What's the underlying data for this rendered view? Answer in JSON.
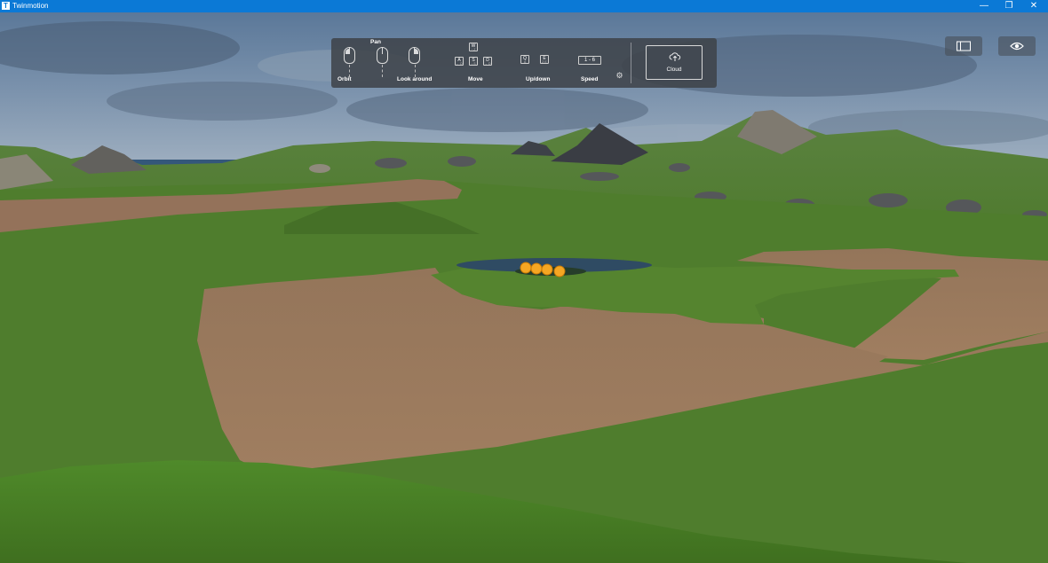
{
  "window": {
    "title": "Twinmotion",
    "app_icon": "T",
    "controls": {
      "minimize": "—",
      "maximize": "❐",
      "close": "✕"
    }
  },
  "nav_help": {
    "orbit": {
      "label": "Orbit",
      "icon": "mouse-left-icon"
    },
    "pan": {
      "label": "Pan",
      "icon": "mouse-middle-icon"
    },
    "look_around": {
      "label": "Look around",
      "icon": "mouse-right-icon"
    },
    "move": {
      "label": "Move",
      "keys": [
        {
          "key": "W",
          "sub": "↑ Z"
        },
        {
          "key": "A",
          "sub": "← Q"
        },
        {
          "key": "S",
          "sub": "↓ S"
        },
        {
          "key": "D",
          "sub": "→ D"
        }
      ]
    },
    "updown": {
      "label": "Up/down",
      "keys": [
        {
          "key": "Q",
          "sub": "A"
        },
        {
          "key": "E",
          "sub": "Z E"
        }
      ]
    },
    "speed": {
      "label": "Speed",
      "keys_text": "1 - 6"
    },
    "settings_icon": "gear-icon"
  },
  "cloud_button": {
    "label": "Cloud",
    "icon": "cloud-upload-icon"
  },
  "toolbar_right": {
    "panel_toggle_icon": "panel-toggle-icon",
    "view_icon": "eye-icon"
  },
  "colors": {
    "titlebar": "#0b79d6",
    "sky": "#6f88a6",
    "grass": "#4f7f2c",
    "dirt": "#9b7a5c",
    "water": "#2f4b63",
    "marker": "#f5a623"
  }
}
